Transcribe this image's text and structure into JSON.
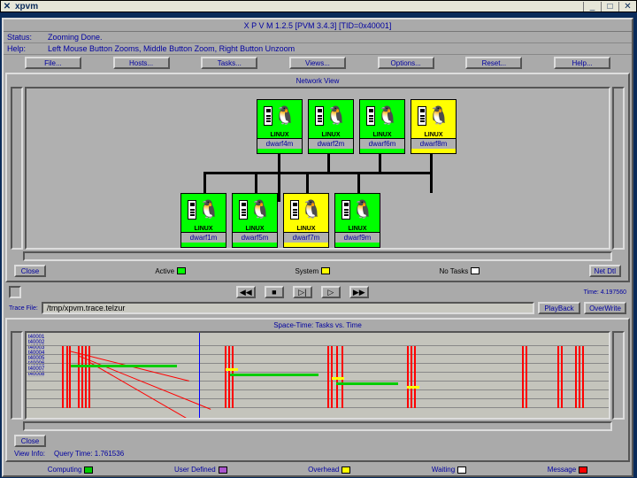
{
  "window": {
    "title": "xpvm"
  },
  "header": "X P V M  1.2.5  [PVM 3.4.3]  [TID=0x40001]",
  "status": {
    "label": "Status:",
    "text": "Zooming Done."
  },
  "help": {
    "label": "Help:",
    "text": "Left Mouse Button Zooms, Middle Button Zoom, Right Button Unzoom"
  },
  "toolbar": {
    "file": "File...",
    "hosts": "Hosts...",
    "tasks": "Tasks...",
    "views": "Views...",
    "options": "Options...",
    "reset": "Reset...",
    "help": "Help..."
  },
  "netview": {
    "title": "Network View",
    "legend_active": "Active",
    "legend_system": "System",
    "legend_notasks": "No Tasks",
    "close": "Close",
    "detail": "Net Dtl",
    "os_label": "LINUX",
    "hosts_top": [
      "dwarf4m",
      "dwarf2m",
      "dwarf6m",
      "dwarf8m"
    ],
    "hosts_bottom": [
      "dwarf1m",
      "dwarf5m",
      "dwarf7m",
      "dwarf9m"
    ],
    "states_top": [
      "green",
      "green",
      "green",
      "yellow"
    ],
    "states_bottom": [
      "green",
      "green",
      "yellow",
      "green"
    ]
  },
  "playback": {
    "time": "Time: 4.197560",
    "trace_label": "Trace File:",
    "trace_file": "/tmp/xpvm.trace.telzur",
    "playback_btn": "PlayBack",
    "overwrite_btn": "OverWrite"
  },
  "trace": {
    "title": "Space-Time: Tasks vs. Time",
    "close": "Close",
    "view_info_label": "View Info:",
    "view_info_value": "Query Time: 1.761536"
  },
  "footer": {
    "computing": "Computing",
    "userdef": "User Defined",
    "overhead": "Overhead",
    "waiting": "Waiting",
    "message": "Message"
  },
  "colors": {
    "active": "#00ff00",
    "system": "#ffff00",
    "notasks": "#ffffff",
    "computing": "#00cc00",
    "userdef": "#aa55cc",
    "overhead": "#ffff00",
    "waiting": "#ffffff",
    "message": "#ff0000"
  }
}
